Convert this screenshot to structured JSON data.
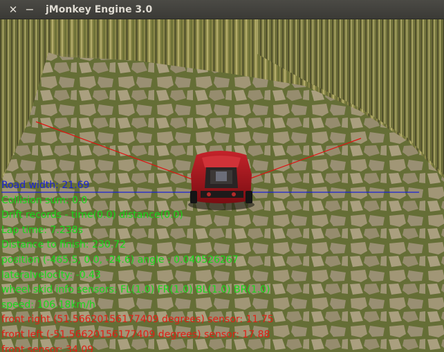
{
  "window": {
    "title": "jMonkey Engine 3.0",
    "close_glyph": "✕",
    "minimize_glyph": "−"
  },
  "hud": {
    "road_width": "Road width: 21.69",
    "collision_sum": "Collision sum: 0.0",
    "drift_records": "Drift records - time(0.0) distance(0.0)",
    "lap_time": "Lap time: 7.238s",
    "distance_to_finish": "Distance to finish: 230.72",
    "position_angle": "position (-465.5, 0.0, -24.6) angle : 0.040526267",
    "lateral_velocity": "lateralvelocity: -0.43",
    "wheel_skid": "wheel skid info sensors: FL(1.0) FR(1.0) BL(1.0) BR(1.0)",
    "speed": "speed: 106.18km/h",
    "front_right_sensor": "front right (51.56620156177409 degrees) sensor: 11.75",
    "front_left_sensor": "front left (-51.56620156177409 degrees) sensor: 17.88",
    "front_sensor": "front sensor: 34.09"
  },
  "colors": {
    "titlebar": "#3c3b37",
    "title_text": "#dfdbd2",
    "hud_blue": "#1a22d6",
    "hud_green": "#18d81a",
    "hud_red": "#e01e14",
    "car_body": "#a3121a",
    "wall": "#8e8a4a",
    "road": "#8c8660"
  }
}
